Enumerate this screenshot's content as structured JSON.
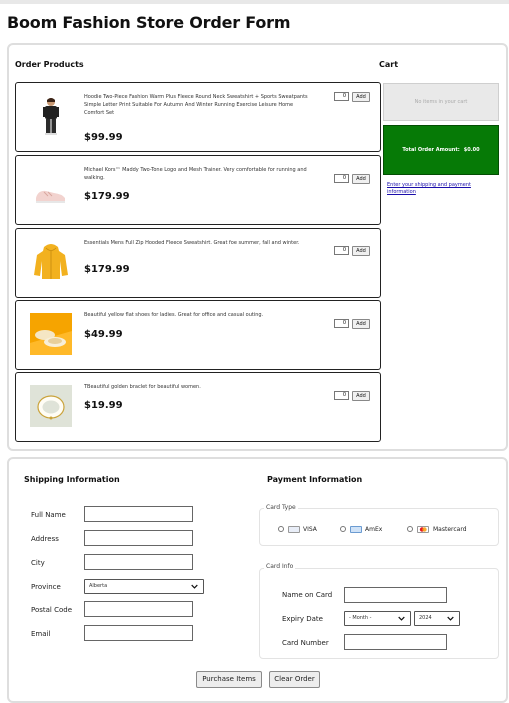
{
  "page": {
    "title": "Boom Fashion Store Order Form"
  },
  "order": {
    "heading": "Order Products",
    "products": [
      {
        "description": "Hoodie Two-Piece Fashion Warm Plus Fleece Round Neck Sweatshirt + Sports Sweatpants Simple Letter Print Suitable For Autumn And Winter Running Exercise Leisure Home Comfort Set",
        "price": "$99.99",
        "qty": "0",
        "add_label": "Add",
        "image": "tracksuit-figure"
      },
      {
        "description": "Michael Kors™ Maddy Two-Tone Logo and Mesh Trainer. Very comfortable for running and walking.",
        "price": "$179.99",
        "qty": "0",
        "add_label": "Add",
        "image": "pink-sneaker"
      },
      {
        "description": "Essentials Mens Full Zip Hooded Fleece Sweatshirt. Great foe summer, fall and winter.",
        "price": "$179.99",
        "qty": "0",
        "add_label": "Add",
        "image": "yellow-hoodie"
      },
      {
        "description": "Beautiful yellow flat shoes for ladies. Great for office and casual outing.",
        "price": "$49.99",
        "qty": "0",
        "add_label": "Add",
        "image": "yellow-flats"
      },
      {
        "description": "TBeautiful golden braclet for beautiful women.",
        "price": "$19.99",
        "qty": "0",
        "add_label": "Add",
        "image": "gold-bracelet"
      }
    ]
  },
  "cart": {
    "heading": "Cart",
    "empty_text": "No items in your cart",
    "total_label": "Total Order Amount:",
    "total_value": "$0.00",
    "shipping_link": "Enter your shipping and payment information",
    "colors": {
      "total_bg": "#067a06"
    }
  },
  "shipping": {
    "heading": "Shipping Information",
    "fields": {
      "full_name": "Full Name",
      "address": "Address",
      "city": "City",
      "province": "Province",
      "postal_code": "Postal Code",
      "email": "Email"
    },
    "province_selected": "Alberta"
  },
  "payment": {
    "heading": "Payment Information",
    "card_type_legend": "Card Type",
    "card_types": [
      "VISA",
      "AmEx",
      "Mastercard"
    ],
    "card_info_legend": "Card Info",
    "fields": {
      "name_on_card": "Name on Card",
      "expiry_date": "Expiry Date",
      "card_number": "Card Number"
    },
    "expiry_month": "- Month -",
    "expiry_year": "2024"
  },
  "actions": {
    "purchase": "Purchase Items",
    "clear": "Clear Order"
  }
}
